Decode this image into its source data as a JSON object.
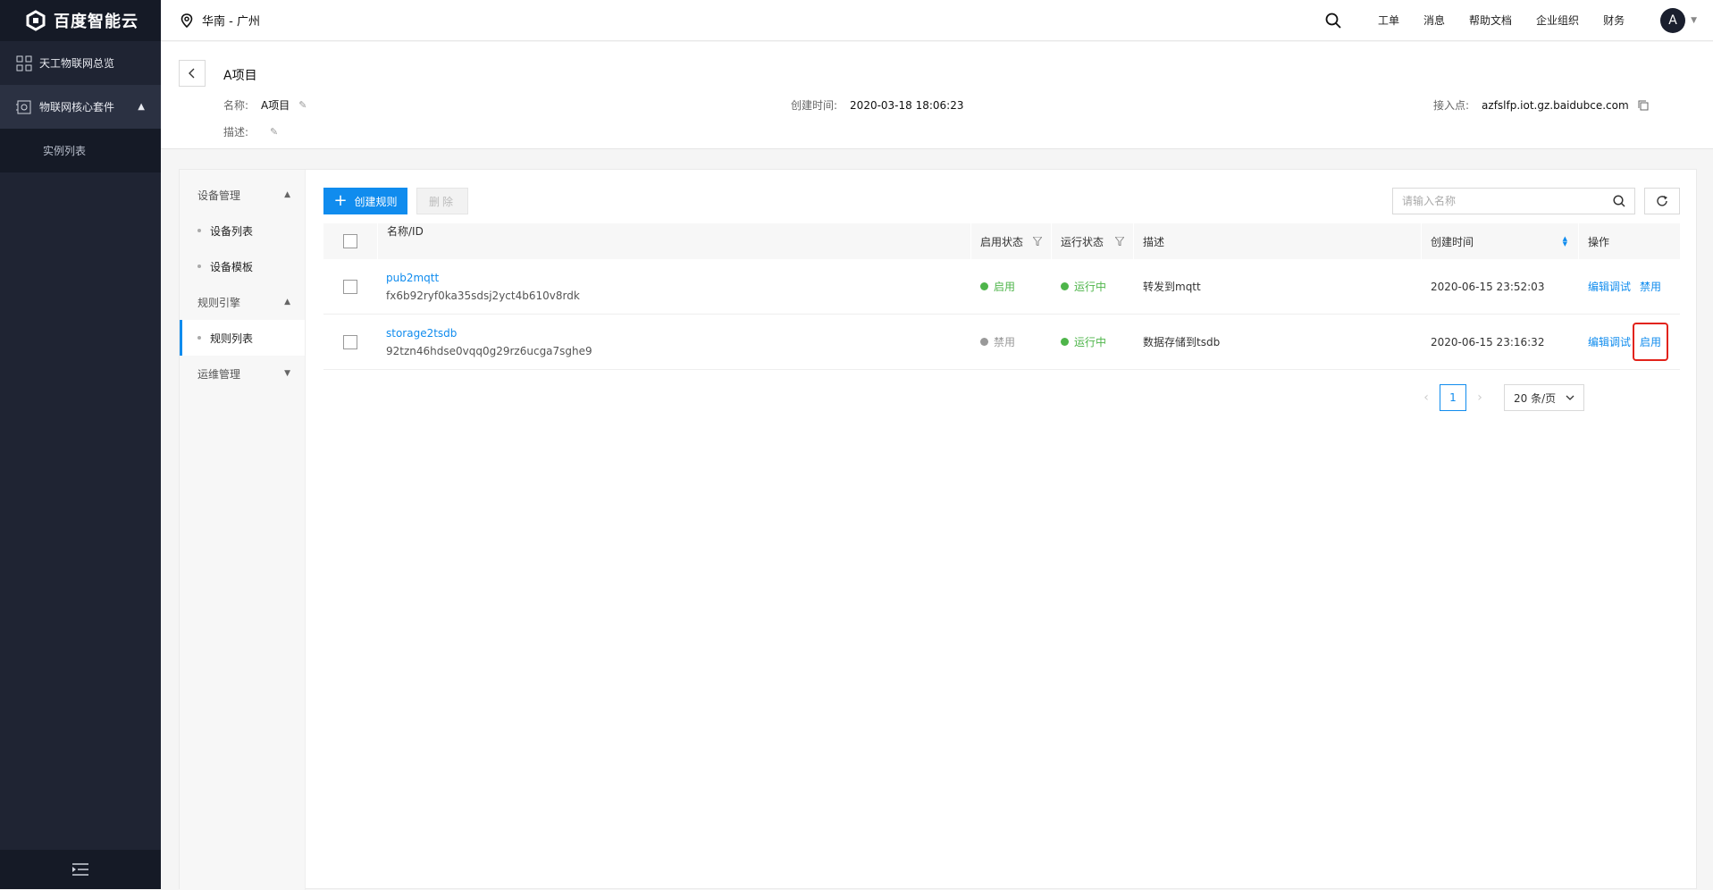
{
  "brand": {
    "name": "百度智能云"
  },
  "sidebar": {
    "items": [
      {
        "label": "天工物联网总览",
        "icon": "grid-icon"
      },
      {
        "label": "物联网核心套件",
        "icon": "module-icon"
      }
    ],
    "sub_items": [
      {
        "label": "实例列表"
      }
    ]
  },
  "topbar": {
    "region": "华南 - 广州",
    "nav": [
      "工单",
      "消息",
      "帮助文档",
      "企业组织",
      "财务"
    ],
    "avatar": "A"
  },
  "project": {
    "title": "A项目",
    "name_label": "名称:",
    "name_value": "A项目",
    "desc_label": "描述:",
    "created_label": "创建时间:",
    "created_value": "2020-03-18 18:06:23",
    "endpoint_label": "接入点:",
    "endpoint_value": "azfslfp.iot.gz.baidubce.com"
  },
  "subnav": {
    "device_group": "设备管理",
    "device_list": "设备列表",
    "device_template": "设备模板",
    "rule_group": "规则引擎",
    "rule_list": "规则列表",
    "ops_group": "运维管理"
  },
  "toolbar": {
    "create_label": "创建规则",
    "delete_label": "删除",
    "search_placeholder": "请输入名称"
  },
  "table": {
    "headers": {
      "name": "名称/ID",
      "enable": "启用状态",
      "run": "运行状态",
      "desc": "描述",
      "time": "创建时间",
      "op": "操作"
    },
    "rows": [
      {
        "name": "pub2mqtt",
        "id": "fx6b92ryf0ka35sdsj2yct4b610v8rdk",
        "enable": "启用",
        "run": "运行中",
        "desc": "转发到mqtt",
        "time": "2020-06-15 23:52:03",
        "op1": "编辑调试",
        "op2": "禁用"
      },
      {
        "name": "storage2tsdb",
        "id": "92tzn46hdse0vqq0g29rz6ucga7sghe9",
        "enable": "禁用",
        "run": "运行中",
        "desc": "数据存储到tsdb",
        "time": "2020-06-15 23:16:32",
        "op1": "编辑调试",
        "op2": "启用"
      }
    ]
  },
  "pager": {
    "current": "1",
    "page_size": "20 条/页"
  },
  "colors": {
    "accent": "#108cee",
    "success": "#4eb54a",
    "sidebar_bg": "#1f2433",
    "highlight": "#e2231a"
  }
}
